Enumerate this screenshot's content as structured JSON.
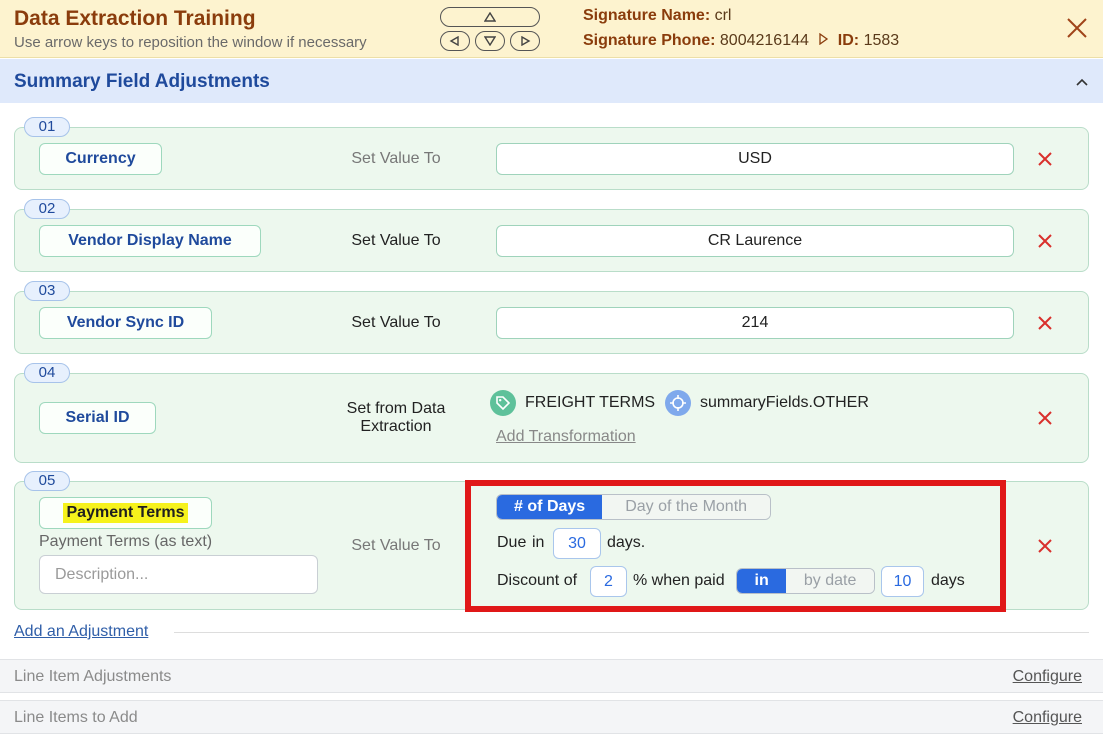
{
  "header": {
    "title": "Data Extraction Training",
    "subtitle": "Use arrow keys to reposition the window if necessary",
    "signature_name_label": "Signature Name:",
    "signature_name": "crl",
    "signature_phone_label": "Signature Phone:",
    "signature_phone": "8004216144",
    "id_label": "ID:",
    "id": "1583"
  },
  "section": {
    "title": "Summary Field Adjustments"
  },
  "adjustments": [
    {
      "number": "01",
      "field": "Currency",
      "action": "Set Value To",
      "value": "USD"
    },
    {
      "number": "02",
      "field": "Vendor Display Name",
      "action": "Set Value To",
      "value": "CR Laurence"
    },
    {
      "number": "03",
      "field": "Vendor Sync ID",
      "action": "Set Value To",
      "value": "214"
    },
    {
      "number": "04",
      "field": "Serial ID",
      "action": "Set from Data Extraction",
      "tag": "FREIGHT TERMS",
      "source": "summaryFields.OTHER",
      "link": "Add Transformation"
    },
    {
      "number": "05",
      "field": "Payment Terms",
      "field_sub": "Payment Terms (as text)",
      "description_placeholder": "Description...",
      "action": "Set Value To",
      "tabs": [
        "# of Days",
        "Day of the Month"
      ],
      "active_tab": "# of Days",
      "due_prefix": "Due",
      "due_in": "in",
      "due_days": "30",
      "due_suffix": "days.",
      "discount_label": "Discount of",
      "discount_value": "2",
      "discount_text": "% when paid",
      "paid_options": [
        "in",
        "by date"
      ],
      "paid_active": "in",
      "paid_days": "10",
      "paid_suffix": "days"
    }
  ],
  "add_adjustment": "Add an Adjustment",
  "line_item_adjustments": {
    "label": "Line Item Adjustments",
    "configure": "Configure"
  },
  "line_items_to_add": {
    "label": "Line Items to Add",
    "configure": "Configure"
  },
  "colors": {
    "accent": "#2a6ae0",
    "title": "#8a3c0c",
    "delete": "#d9302c",
    "highlight": "#f6f21c",
    "frame": "#e01818"
  }
}
